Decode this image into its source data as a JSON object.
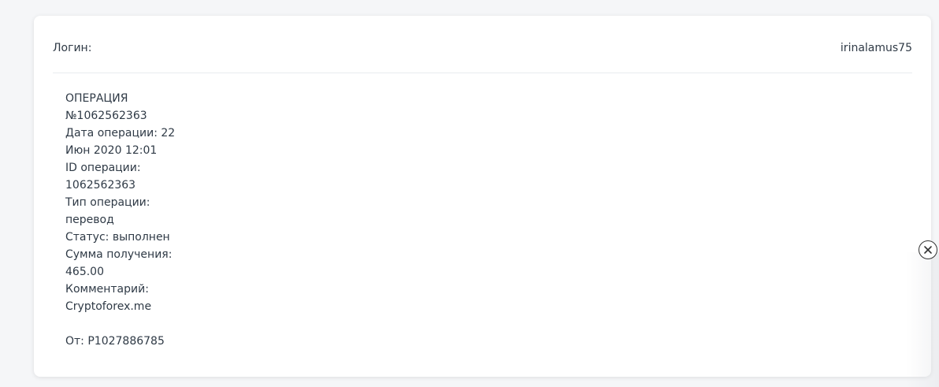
{
  "login": {
    "label": "Логин:",
    "value": "irinalamus75"
  },
  "operation": {
    "lines": [
      "ОПЕРАЦИЯ",
      "№1062562363",
      "Дата операции: 22",
      "Июн 2020 12:01",
      "ID операции:",
      "1062562363",
      "Тип операции:",
      "перевод",
      "Статус: выполнен",
      "Сумма получения:",
      "465.00",
      "Комментарий:",
      "Cryptoforex.me"
    ],
    "from": "От: P1027886785"
  },
  "close_button": {
    "icon": "close-icon"
  }
}
